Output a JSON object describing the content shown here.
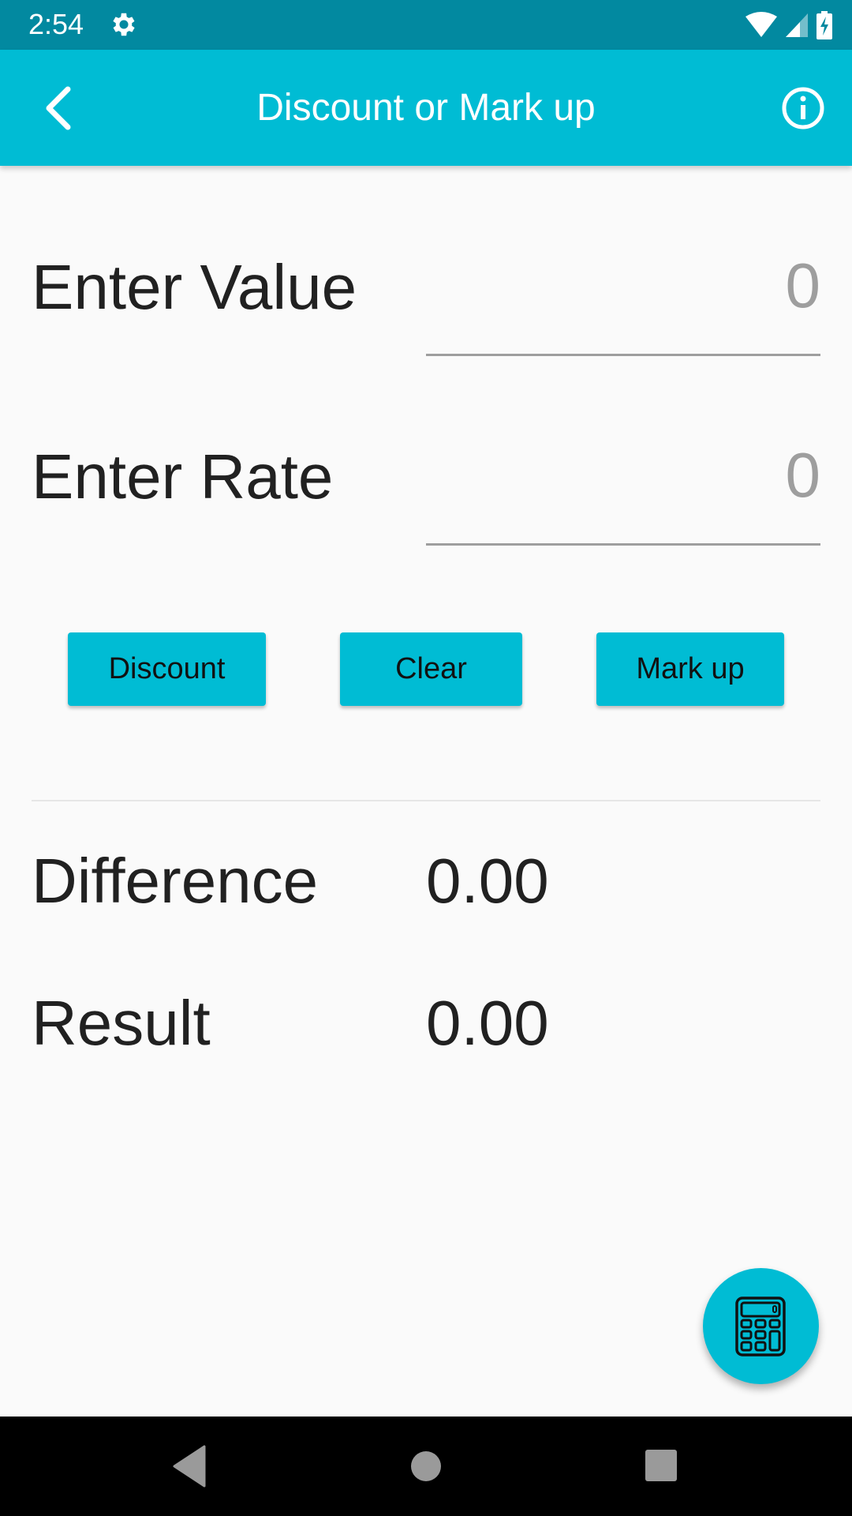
{
  "status_bar": {
    "time": "2:54",
    "icons": [
      "settings-icon",
      "wifi-icon",
      "signal-icon",
      "battery-charging-icon"
    ]
  },
  "app_bar": {
    "title": "Discount or Mark up",
    "back_icon": "chevron-left-icon",
    "info_icon": "info-icon"
  },
  "form": {
    "value": {
      "label": "Enter Value",
      "current": "",
      "placeholder": "0"
    },
    "rate": {
      "label": "Enter Rate",
      "current": "",
      "placeholder": "0"
    }
  },
  "buttons": {
    "discount": "Discount",
    "clear": "Clear",
    "markup": "Mark up"
  },
  "results": {
    "difference": {
      "label": "Difference",
      "value": "0.00"
    },
    "result": {
      "label": "Result",
      "value": "0.00"
    }
  },
  "fab": {
    "icon": "calculator-icon"
  },
  "nav_bar": {
    "icons": [
      "nav-back-icon",
      "nav-home-icon",
      "nav-recents-icon"
    ]
  },
  "colors": {
    "primary": "#00bcd4",
    "primary_dark": "#0289a0",
    "background": "#fafafa",
    "text": "#212121",
    "hint": "#9e9e9e"
  }
}
